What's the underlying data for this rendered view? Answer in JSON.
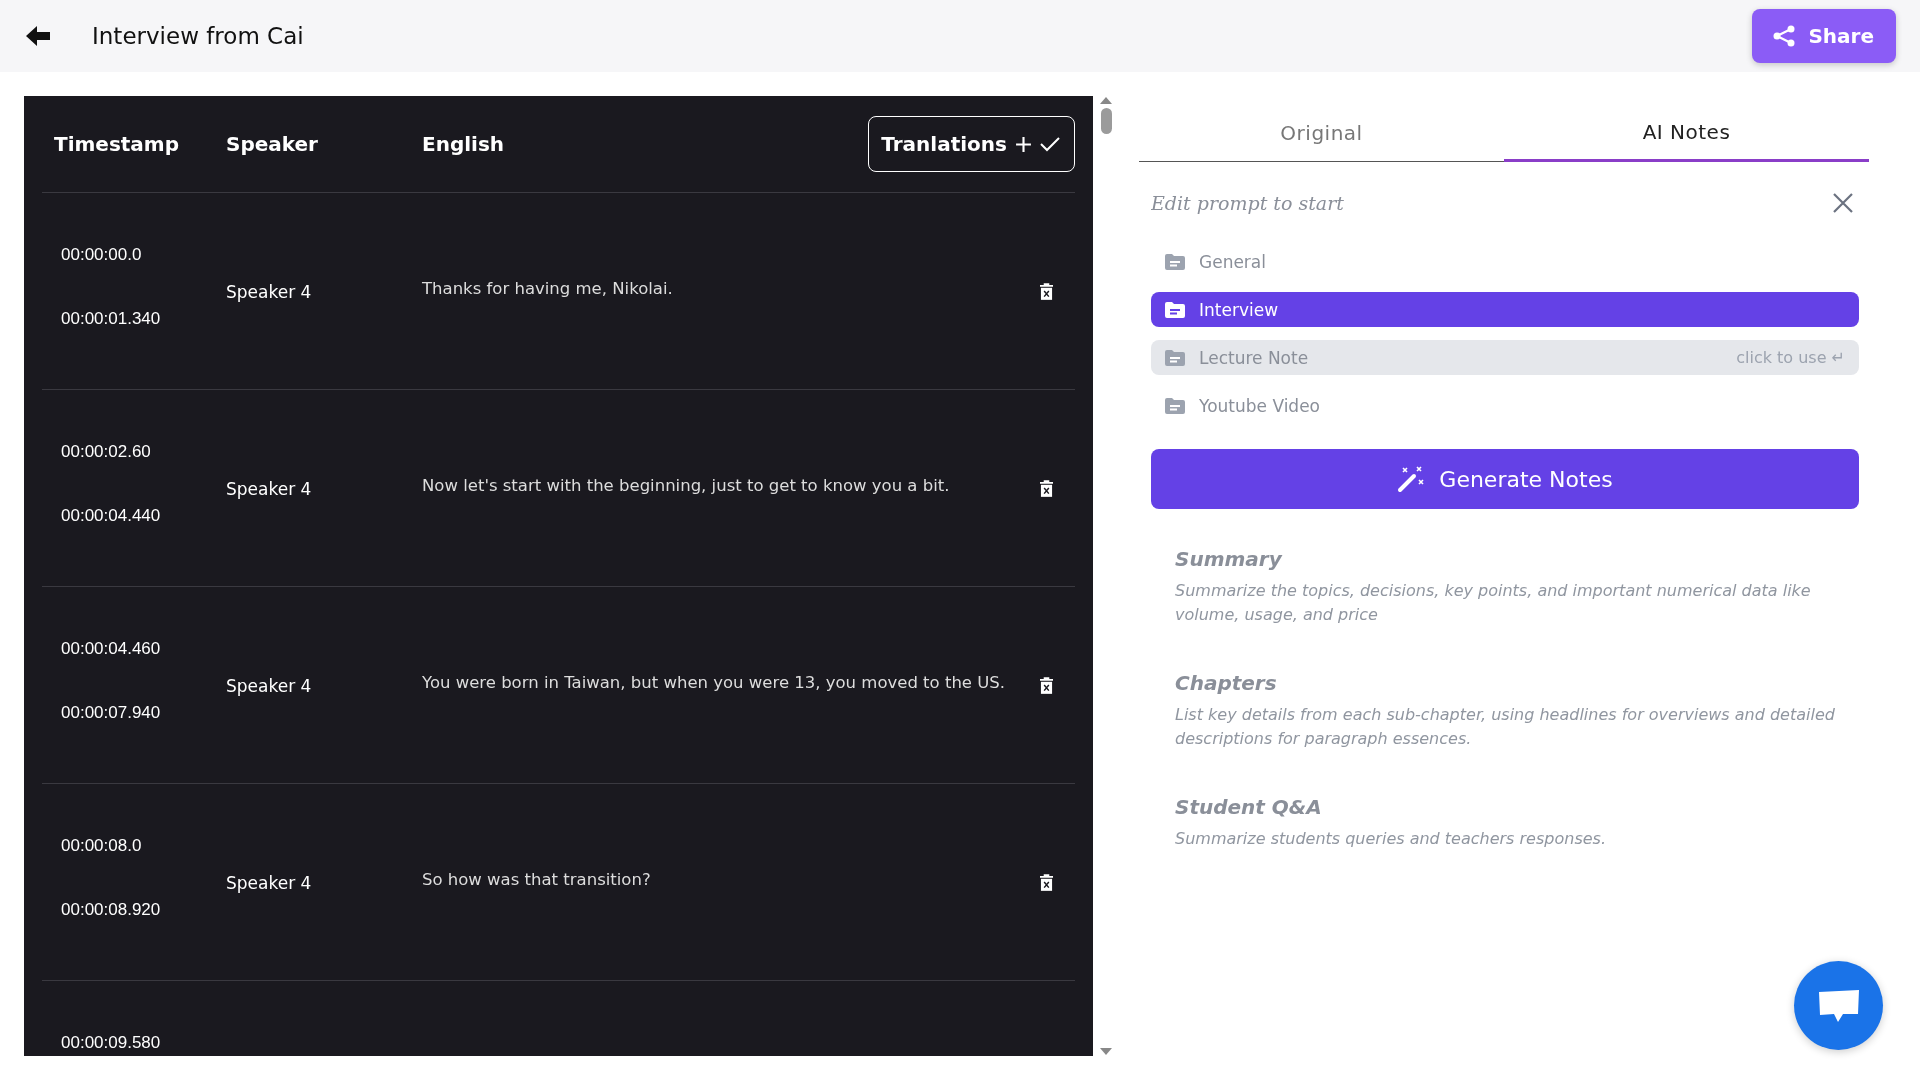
{
  "header": {
    "title": "Interview from Cai",
    "share_label": "Share"
  },
  "transcript": {
    "columns": [
      "Timestamp",
      "Speaker",
      "English"
    ],
    "translations_label": "Tranlations",
    "rows": [
      {
        "start": "00:00:00.0",
        "end": "00:00:01.340",
        "speaker": "Speaker 4",
        "text": "Thanks for having me, Nikolai."
      },
      {
        "start": "00:00:02.60",
        "end": "00:00:04.440",
        "speaker": "Speaker 4",
        "text": "Now let's start with the beginning, just to get to know you a bit."
      },
      {
        "start": "00:00:04.460",
        "end": "00:00:07.940",
        "speaker": "Speaker 4",
        "text": "You were born in Taiwan, but when you were 13, you moved to the US."
      },
      {
        "start": "00:00:08.0",
        "end": "00:00:08.920",
        "speaker": "Speaker 4",
        "text": "So how was that transition?"
      },
      {
        "start": "00:00:09.580"
      }
    ]
  },
  "tabs": [
    {
      "label": "Original",
      "selected": false
    },
    {
      "label": "AI Notes",
      "selected": true
    }
  ],
  "prompt": {
    "placeholder": "Edit prompt to start"
  },
  "templates": [
    {
      "label": "General",
      "selected": false,
      "hovered": false
    },
    {
      "label": "Interview",
      "selected": true,
      "hovered": false
    },
    {
      "label": "Lecture Note",
      "selected": false,
      "hovered": true,
      "hint": "click to use ↵"
    },
    {
      "label": "Youtube Video",
      "selected": false,
      "hovered": false
    }
  ],
  "generate_label": "Generate Notes",
  "sections": [
    {
      "title": "Summary",
      "description": "Summarize the topics, decisions, key points, and important numerical data like volume, usage, and price"
    },
    {
      "title": "Chapters",
      "description": "List key details from each sub-chapter, using headlines for overviews and detailed descriptions for paragraph essences."
    },
    {
      "title": "Student Q&A",
      "description": "Summarize students queries and teachers responses."
    }
  ]
}
